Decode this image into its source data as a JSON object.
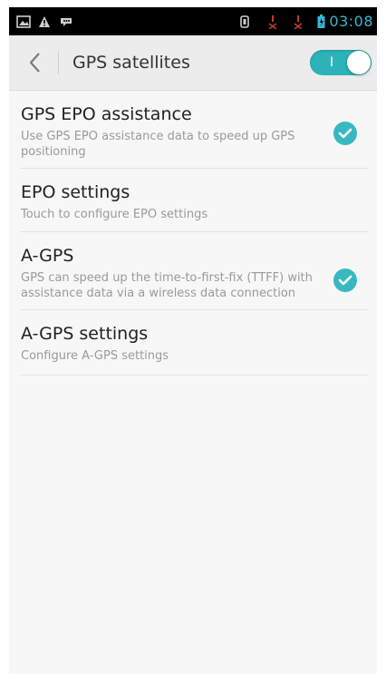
{
  "status_bar": {
    "time": "03:08",
    "icons": [
      "image-icon",
      "warning-icon",
      "message-icon",
      "sim-icon",
      "signal-off-icon",
      "signal-off-icon",
      "battery-icon"
    ]
  },
  "header": {
    "title": "GPS satellites",
    "toggle_label": "I"
  },
  "settings": [
    {
      "title": "GPS EPO assistance",
      "subtitle": "Use GPS EPO assistance data to speed up GPS positioning",
      "checked": true
    },
    {
      "title": "EPO settings",
      "subtitle": "Touch to configure EPO settings",
      "checked": false
    },
    {
      "title": "A-GPS",
      "subtitle": "GPS can speed up the time-to-first-fix (TTFF) with assistance data via a wireless data connection",
      "checked": true
    },
    {
      "title": "A-GPS settings",
      "subtitle": "Configure A-GPS settings",
      "checked": false
    }
  ],
  "colors": {
    "accent": "#2cb3b9",
    "check": "#3ab8c2",
    "time": "#37b7d2"
  }
}
